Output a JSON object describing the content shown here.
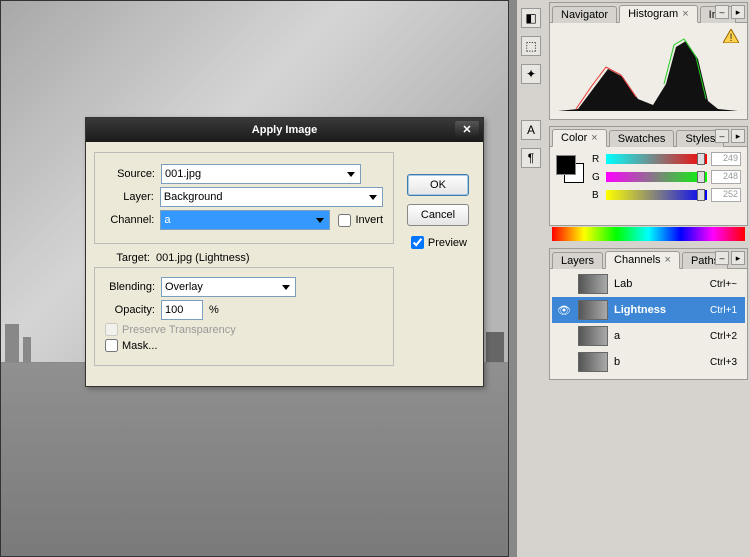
{
  "dialog": {
    "title": "Apply Image",
    "source_label": "Source:",
    "source_value": "001.jpg",
    "layer_label": "Layer:",
    "layer_value": "Background",
    "channel_label": "Channel:",
    "channel_value": "a",
    "invert_label": "Invert",
    "target_label": "Target:",
    "target_value": "001.jpg (Lightness)",
    "blending_label": "Blending:",
    "blending_value": "Overlay",
    "opacity_label": "Opacity:",
    "opacity_value": "100",
    "opacity_suffix": "%",
    "preserve_label": "Preserve Transparency",
    "mask_label": "Mask...",
    "ok": "OK",
    "cancel": "Cancel",
    "preview": "Preview"
  },
  "panels": {
    "nav": {
      "tabs": [
        "Navigator",
        "Histogram",
        "Info"
      ],
      "active": 1
    },
    "color": {
      "tabs": [
        "Color",
        "Swatches",
        "Styles"
      ],
      "active": 0,
      "channels": [
        {
          "l": "R",
          "v": "249"
        },
        {
          "l": "G",
          "v": "248"
        },
        {
          "l": "B",
          "v": "252"
        }
      ]
    },
    "chan": {
      "tabs": [
        "Layers",
        "Channels",
        "Paths"
      ],
      "active": 1,
      "rows": [
        {
          "name": "Lab",
          "sc": "Ctrl+~",
          "sel": false,
          "eye": false
        },
        {
          "name": "Lightness",
          "sc": "Ctrl+1",
          "sel": true,
          "eye": true
        },
        {
          "name": "a",
          "sc": "Ctrl+2",
          "sel": false,
          "eye": false
        },
        {
          "name": "b",
          "sc": "Ctrl+3",
          "sel": false,
          "eye": false
        }
      ]
    }
  }
}
